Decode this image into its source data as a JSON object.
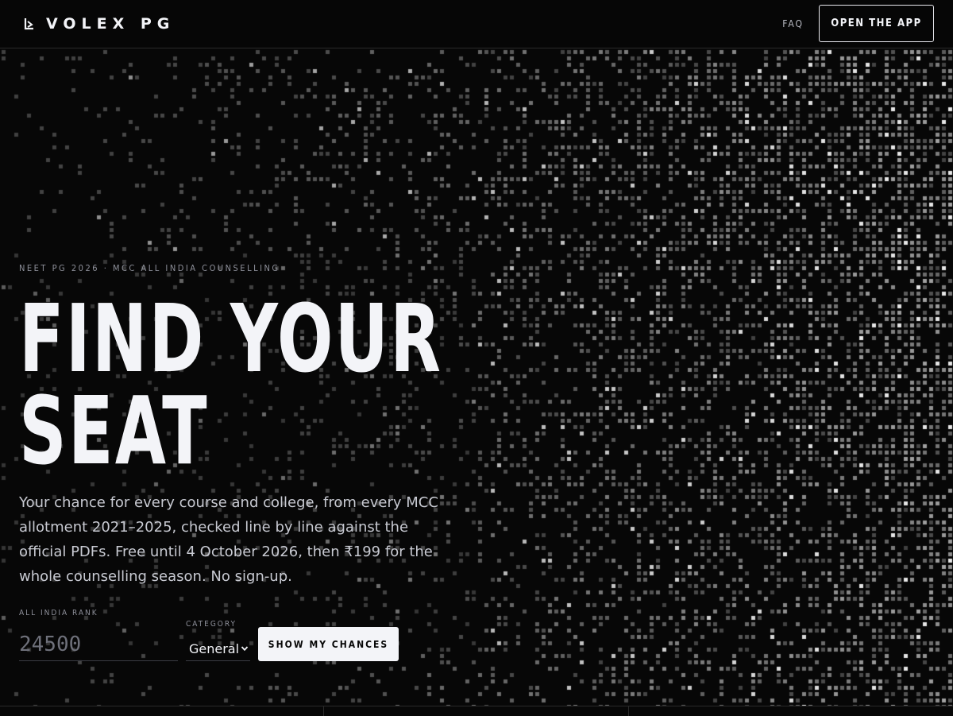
{
  "header": {
    "brand": "VOLEX PG",
    "logo_icon": "volex-logo-icon",
    "nav_faq": "FAQ",
    "open_app_label": "OPEN THE APP"
  },
  "hero": {
    "eyebrow": "NEET PG 2026 · MCC ALL INDIA COUNSELLING",
    "headline_line1": "FIND YOUR",
    "headline_line2": "SEAT",
    "subtext": "Your chance for every course and college, from every MCC allotment 2021–2025, checked line by line against the official PDFs. Free until 4 October 2026, then ₹199 for the whole counselling season. No sign-up."
  },
  "form": {
    "rank_label": "ALL INDIA RANK",
    "rank_placeholder": "24500",
    "category_label": "CATEGORY",
    "category_value": "General",
    "submit_label": "SHOW MY CHANCES"
  },
  "colors": {
    "background": "#070707",
    "text": "#f3f4f8",
    "muted": "#8e909a",
    "button_bg": "#f3f4f8"
  }
}
